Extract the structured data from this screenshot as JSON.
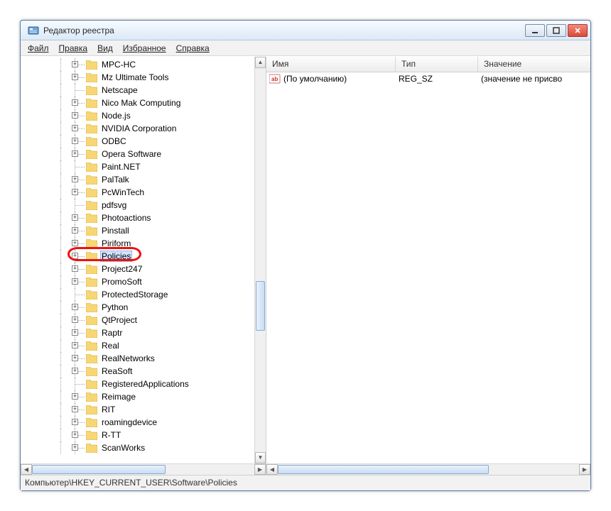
{
  "window": {
    "title": "Редактор реестра"
  },
  "menu": {
    "file": "Файл",
    "edit": "Правка",
    "view": "Вид",
    "favorites": "Избранное",
    "help": "Справка"
  },
  "tree": {
    "items": [
      {
        "label": "MPC-HC",
        "exp": true
      },
      {
        "label": "Mz Ultimate Tools",
        "exp": true
      },
      {
        "label": "Netscape",
        "exp": false
      },
      {
        "label": "Nico Mak Computing",
        "exp": true
      },
      {
        "label": "Node.js",
        "exp": true
      },
      {
        "label": "NVIDIA Corporation",
        "exp": true
      },
      {
        "label": "ODBC",
        "exp": true
      },
      {
        "label": "Opera Software",
        "exp": true
      },
      {
        "label": "Paint.NET",
        "exp": false
      },
      {
        "label": "PalTalk",
        "exp": true
      },
      {
        "label": "PcWinTech",
        "exp": true
      },
      {
        "label": "pdfsvg",
        "exp": false
      },
      {
        "label": "Photoactions",
        "exp": true
      },
      {
        "label": "Pinstall",
        "exp": true
      },
      {
        "label": "Piriform",
        "exp": true
      },
      {
        "label": "Policies",
        "exp": true,
        "selected": true,
        "highlight": true
      },
      {
        "label": "Project247",
        "exp": true
      },
      {
        "label": "PromoSoft",
        "exp": true
      },
      {
        "label": "ProtectedStorage",
        "exp": false
      },
      {
        "label": "Python",
        "exp": true
      },
      {
        "label": "QtProject",
        "exp": true
      },
      {
        "label": "Raptr",
        "exp": true
      },
      {
        "label": "Real",
        "exp": true
      },
      {
        "label": "RealNetworks",
        "exp": true
      },
      {
        "label": "ReaSoft",
        "exp": true
      },
      {
        "label": "RegisteredApplications",
        "exp": false
      },
      {
        "label": "Reimage",
        "exp": true
      },
      {
        "label": "RIT",
        "exp": true
      },
      {
        "label": "roamingdevice",
        "exp": true
      },
      {
        "label": "R-TT",
        "exp": true
      },
      {
        "label": "ScanWorks",
        "exp": true
      }
    ]
  },
  "list": {
    "columns": {
      "name": "Имя",
      "type": "Тип",
      "value": "Значение"
    },
    "rows": [
      {
        "name": "(По умолчанию)",
        "type": "REG_SZ",
        "value": "(значение не присво"
      }
    ]
  },
  "status": {
    "path": "Компьютер\\HKEY_CURRENT_USER\\Software\\Policies"
  },
  "colors": {
    "highlight_border": "#e11"
  }
}
